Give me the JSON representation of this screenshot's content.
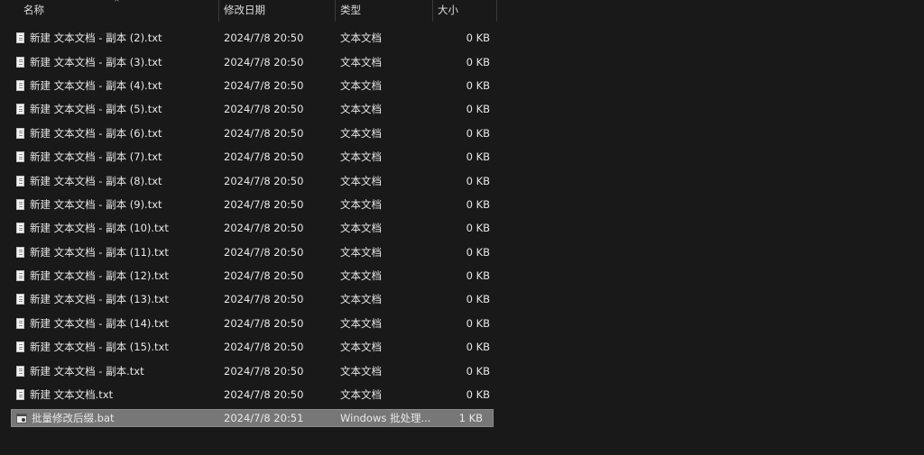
{
  "header": {
    "name": "名称",
    "date": "修改日期",
    "type": "类型",
    "size": "大小",
    "sort_indicator": "^"
  },
  "files": [
    {
      "name": "新建 文本文档 - 副本 (2).txt",
      "date": "2024/7/8 20:50",
      "type": "文本文档",
      "size": "0 KB",
      "icon": "text-file-icon"
    },
    {
      "name": "新建 文本文档 - 副本 (3).txt",
      "date": "2024/7/8 20:50",
      "type": "文本文档",
      "size": "0 KB",
      "icon": "text-file-icon"
    },
    {
      "name": "新建 文本文档 - 副本 (4).txt",
      "date": "2024/7/8 20:50",
      "type": "文本文档",
      "size": "0 KB",
      "icon": "text-file-icon"
    },
    {
      "name": "新建 文本文档 - 副本 (5).txt",
      "date": "2024/7/8 20:50",
      "type": "文本文档",
      "size": "0 KB",
      "icon": "text-file-icon"
    },
    {
      "name": "新建 文本文档 - 副本 (6).txt",
      "date": "2024/7/8 20:50",
      "type": "文本文档",
      "size": "0 KB",
      "icon": "text-file-icon"
    },
    {
      "name": "新建 文本文档 - 副本 (7).txt",
      "date": "2024/7/8 20:50",
      "type": "文本文档",
      "size": "0 KB",
      "icon": "text-file-icon"
    },
    {
      "name": "新建 文本文档 - 副本 (8).txt",
      "date": "2024/7/8 20:50",
      "type": "文本文档",
      "size": "0 KB",
      "icon": "text-file-icon"
    },
    {
      "name": "新建 文本文档 - 副本 (9).txt",
      "date": "2024/7/8 20:50",
      "type": "文本文档",
      "size": "0 KB",
      "icon": "text-file-icon"
    },
    {
      "name": "新建 文本文档 - 副本 (10).txt",
      "date": "2024/7/8 20:50",
      "type": "文本文档",
      "size": "0 KB",
      "icon": "text-file-icon"
    },
    {
      "name": "新建 文本文档 - 副本 (11).txt",
      "date": "2024/7/8 20:50",
      "type": "文本文档",
      "size": "0 KB",
      "icon": "text-file-icon"
    },
    {
      "name": "新建 文本文档 - 副本 (12).txt",
      "date": "2024/7/8 20:50",
      "type": "文本文档",
      "size": "0 KB",
      "icon": "text-file-icon"
    },
    {
      "name": "新建 文本文档 - 副本 (13).txt",
      "date": "2024/7/8 20:50",
      "type": "文本文档",
      "size": "0 KB",
      "icon": "text-file-icon"
    },
    {
      "name": "新建 文本文档 - 副本 (14).txt",
      "date": "2024/7/8 20:50",
      "type": "文本文档",
      "size": "0 KB",
      "icon": "text-file-icon"
    },
    {
      "name": "新建 文本文档 - 副本 (15).txt",
      "date": "2024/7/8 20:50",
      "type": "文本文档",
      "size": "0 KB",
      "icon": "text-file-icon"
    },
    {
      "name": "新建 文本文档 - 副本.txt",
      "date": "2024/7/8 20:50",
      "type": "文本文档",
      "size": "0 KB",
      "icon": "text-file-icon"
    },
    {
      "name": "新建 文本文档.txt",
      "date": "2024/7/8 20:50",
      "type": "文本文档",
      "size": "0 KB",
      "icon": "text-file-icon"
    },
    {
      "name": "批量修改后缀.bat",
      "date": "2024/7/8 20:51",
      "type": "Windows 批处理...",
      "size": "1 KB",
      "icon": "batch-file-icon",
      "selected": true
    }
  ]
}
